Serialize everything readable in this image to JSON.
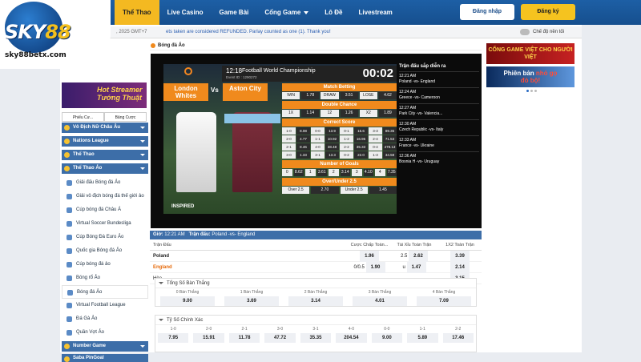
{
  "header": {
    "brand_url": "sky88betx.com",
    "nav": [
      "Thể Thao",
      "Live Casino",
      "Game Bài",
      "Cổng Game",
      "Lô Đề",
      "Livestream"
    ],
    "login": "Đăng nhập",
    "register": "Đăng ký"
  },
  "ticker": {
    "date": ", 2025 GMT+7",
    "message": "ets taken are considered REFUNDED. Parlay counted as one (1). Thank you!",
    "toggle_label": "Chế độ nền tối"
  },
  "sidebar": {
    "banner": "Hot Streamer Tướng Thuật",
    "tabs": [
      "Phiếu Cư...",
      "Bảng Cược"
    ],
    "sections": [
      {
        "label": "Vô Địch Nữ Châu Âu"
      },
      {
        "label": "Nations League"
      },
      {
        "label": "Thể Thao"
      },
      {
        "label": "Thể Thao Ảo"
      }
    ],
    "items": [
      "Giải đấu Bóng đá Ảo",
      "Giải vô địch bóng đá thế giới ảo",
      "Cúp bóng đá Châu Á",
      "Virtual Soccer Bundesliga",
      "Cúp Bóng Đá Euro Ảo",
      "Quốc gia Bóng đá Ảo",
      "Cúp bóng đá ảo",
      "Bóng rổ Ảo",
      "Bóng đá Ảo",
      "Virtual Football League",
      "Đá Gà Ảo",
      "Quần Vợt Ảo"
    ],
    "bottom_sections": [
      "Number Game",
      "Saba PinGoal"
    ]
  },
  "content": {
    "title": "Bóng đá Ảo",
    "video": {
      "time": "12:18",
      "event_id": "Event ID : 1290272",
      "tournament": "Football World Championship",
      "clock": "00:02",
      "team_a": "London Whites",
      "vs": "Vs",
      "team_b": "Aston City",
      "watermark": "INSPIRED",
      "match_betting": {
        "label": "Match Betting",
        "cells": [
          "WIN",
          "1.78",
          "DRAW",
          "3.51",
          "LOSE",
          "4.62"
        ]
      },
      "double_chance": {
        "label": "Double Chance",
        "cells": [
          "1X",
          "1.14",
          "12",
          "1.26",
          "X2",
          "1.89"
        ]
      },
      "correct_score": {
        "label": "Correct Score",
        "cells": [
          "1-0",
          "8.08",
          "0-0",
          "13.9",
          "0-1",
          "15.6",
          "3-3",
          "89.35",
          "2-0",
          "4.77",
          "1-1",
          "10.92",
          "1-2",
          "16.95",
          "2-4",
          "71.53",
          "2-1",
          "8.46",
          "4-0",
          "38.48",
          "2-2",
          "35.33",
          "0-4",
          "478.13",
          "3-0",
          "1.33",
          "3-1",
          "13.3",
          "0-2",
          "22.0",
          "1-3",
          "34.58"
        ]
      },
      "number_goals": {
        "label": "Number of Goals",
        "cells": [
          "0",
          "8.62",
          "1",
          "3.61",
          "2",
          "3.14",
          "3",
          "4.10",
          "4",
          "7.35"
        ]
      },
      "over_under": {
        "label": "Over/Under 2.5",
        "cells": [
          "Over 2.5",
          "2.70",
          "Under 2.5",
          "1.45"
        ]
      }
    },
    "upcoming": {
      "title": "Trận đấu sắp diễn ra",
      "entries": [
        {
          "time": "12:21 AM",
          "match": "Poland -vs- England"
        },
        {
          "time": "12:24 AM",
          "match": "Greece -vs- Cameroon"
        },
        {
          "time": "12:27 AM",
          "match": "Park City -vs- Valencia..."
        },
        {
          "time": "12:30 AM",
          "match": "Czech Republic -vs- Italy"
        },
        {
          "time": "12:33 AM",
          "match": "France -vs- Ukraine"
        },
        {
          "time": "12:36 AM",
          "match": "Bosnia H -vs- Uruguay"
        }
      ]
    },
    "match_header": {
      "time_label": "Giờ:",
      "time": "12:21 AM",
      "match_label": "Trận đấu:",
      "match": "Poland -vs- England"
    },
    "table": {
      "columns": [
        "Trận Đấu",
        "Cược Chấp Toàn...",
        "Tài Xỉu Toàn Trận",
        "1X2 Toàn Trận"
      ],
      "rows": [
        {
          "team": "Poland",
          "hcap_line": "",
          "hcap": "1.96",
          "ou_line": "2.5",
          "ou": "2.62",
          "x12": "3.39"
        },
        {
          "team": "England",
          "hcap_line": "0/0.5",
          "hcap": "1.90",
          "ou_line": "u",
          "ou": "1.47",
          "x12": "2.14"
        },
        {
          "team": "Hòa",
          "hcap_line": "",
          "hcap": "",
          "ou_line": "",
          "ou": "",
          "x12": "3.15"
        }
      ]
    },
    "total_goals": {
      "title": "Tổng Số Bàn Thắng",
      "labels": [
        "0 Bàn Thắng",
        "1 Bàn Thắng",
        "2 Bàn Thắng",
        "3 Bàn Thắng",
        "4 Bàn Thắng"
      ],
      "values": [
        "9.00",
        "3.69",
        "3.14",
        "4.01",
        "7.09"
      ]
    },
    "correct_score": {
      "title": "Tỷ Số Chính Xác",
      "labels": [
        "1-0",
        "2-0",
        "2-1",
        "3-0",
        "3-1",
        "4-0",
        "0-0",
        "1-1",
        "2-2"
      ],
      "values_row1": [
        "7.95",
        "15.91",
        "11.78",
        "47.72",
        "35.35",
        "204.54",
        "9.00",
        "5.89",
        "17.46"
      ]
    }
  },
  "right": {
    "banner1": "CỔNG GAME VIỆT CHO NGƯỜI VIỆT",
    "banner2_a": "Phiên bản",
    "banner2_b": "nhỏ gọ",
    "banner2_c": "đỏ bộ!"
  }
}
